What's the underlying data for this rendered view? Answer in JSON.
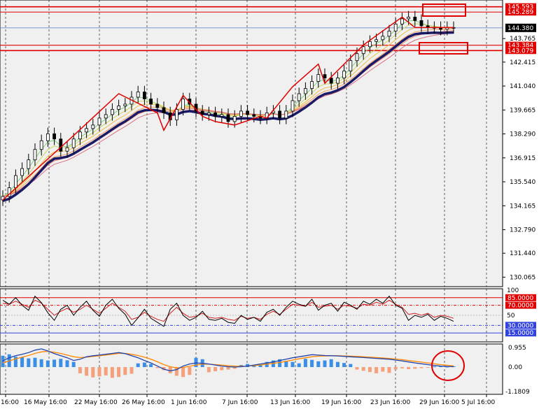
{
  "chart_data": {
    "type": "candlestick",
    "colors": {
      "background": "#f0f0f0",
      "grid": "#000000",
      "bull": "#000000",
      "bear": "#000000",
      "wave": "#e00000",
      "ma_slow": "#1a1a66",
      "level": "#e00000",
      "level_blue": "#5577cc",
      "current": "#000000",
      "hist_pos": "#3a8ee6",
      "hist_neg": "#f4a07a",
      "macd_line": "#2244aa",
      "signal_line": "#ff8800"
    },
    "price_panel": {
      "y_ticks": [
        "143.765",
        "142.415",
        "141.040",
        "139.665",
        "138.290",
        "136.915",
        "135.540",
        "134.165",
        "132.790",
        "131.440",
        "130.065"
      ],
      "ylim": [
        129.6,
        145.9
      ],
      "current_price": "144.380",
      "levels": [
        {
          "label": "145.593",
          "value": 145.593,
          "color": "#e00000",
          "width": 1.6
        },
        {
          "label": "145.289",
          "value": 145.289,
          "color": "#e00000",
          "width": 1
        },
        {
          "label": "143.384",
          "value": 143.384,
          "color": "#e00000",
          "width": 1.2
        },
        {
          "label": "143.079",
          "value": 143.079,
          "color": "#e00000",
          "width": 1.6
        }
      ],
      "blue_level": 144.38,
      "closes": [
        134.7,
        135.2,
        135.9,
        136.3,
        136.8,
        137.4,
        137.9,
        138.3,
        138.0,
        137.3,
        137.5,
        138.0,
        138.4,
        138.6,
        138.8,
        139.2,
        139.4,
        139.7,
        139.9,
        140.0,
        140.4,
        140.7,
        140.3,
        140.0,
        139.8,
        139.5,
        139.1,
        139.7,
        140.3,
        140.0,
        139.6,
        139.4,
        139.5,
        139.3,
        139.4,
        139.0,
        139.3,
        139.6,
        139.4,
        139.3,
        139.2,
        139.5,
        139.6,
        139.2,
        139.6,
        140.2,
        140.6,
        140.9,
        141.3,
        141.7,
        141.5,
        141.2,
        141.5,
        141.9,
        142.5,
        142.9,
        143.3,
        143.6,
        143.7,
        143.9,
        144.2,
        144.6,
        144.9,
        145.0,
        144.8,
        144.5,
        144.4,
        144.4,
        144.3,
        144.4,
        144.4
      ],
      "zigzag": [
        [
          0,
          134.5
        ],
        [
          11,
          138.2
        ],
        [
          18,
          140.6
        ],
        [
          24,
          139.5
        ],
        [
          25,
          138.5
        ],
        [
          28,
          140.5
        ],
        [
          31,
          139.3
        ],
        [
          33,
          139.0
        ],
        [
          36,
          138.8
        ],
        [
          40,
          139.3
        ],
        [
          41,
          139.2
        ],
        [
          45,
          141.0
        ],
        [
          49,
          142.3
        ],
        [
          50,
          141.2
        ],
        [
          56,
          143.4
        ],
        [
          62,
          145.0
        ],
        [
          64,
          144.4
        ],
        [
          70,
          144.4
        ]
      ]
    },
    "rsi_panel": {
      "levels": [
        {
          "label": "85.0000",
          "value": 85,
          "color": "#e00000",
          "dash": ""
        },
        {
          "label": "70.0000",
          "value": 70,
          "color": "#e00000",
          "dash": "4,2,1,2"
        },
        {
          "label": "30.0000",
          "value": 30,
          "color": "#3344dd",
          "dash": "4,2,1,2"
        },
        {
          "label": "15.0000",
          "value": 15,
          "color": "#3344dd",
          "dash": ""
        }
      ],
      "ticks": [
        "100",
        "50"
      ],
      "ylim": [
        0,
        100
      ],
      "black": [
        80,
        72,
        85,
        70,
        60,
        88,
        75,
        55,
        40,
        62,
        70,
        50,
        66,
        78,
        60,
        48,
        70,
        82,
        64,
        52,
        30,
        45,
        62,
        44,
        36,
        28,
        62,
        74,
        50,
        40,
        46,
        58,
        42,
        40,
        44,
        36,
        34,
        50,
        42,
        46,
        38,
        56,
        62,
        50,
        66,
        78,
        72,
        68,
        82,
        60,
        70,
        74,
        58,
        76,
        70,
        62,
        78,
        72,
        82,
        74,
        88,
        70,
        64,
        40,
        50,
        46,
        52,
        40,
        48,
        44,
        38
      ],
      "red": [
        74,
        72,
        78,
        72,
        66,
        80,
        74,
        62,
        50,
        58,
        64,
        56,
        62,
        70,
        62,
        54,
        64,
        74,
        66,
        58,
        42,
        46,
        56,
        48,
        42,
        38,
        54,
        66,
        54,
        46,
        48,
        54,
        46,
        44,
        46,
        42,
        40,
        48,
        44,
        46,
        42,
        52,
        58,
        52,
        62,
        72,
        70,
        68,
        76,
        66,
        68,
        70,
        62,
        70,
        68,
        64,
        72,
        70,
        76,
        72,
        80,
        72,
        66,
        52,
        54,
        50,
        54,
        46,
        50,
        48,
        44
      ]
    },
    "macd_panel": {
      "ticks": [
        "0.955",
        "0.00",
        "-1.1809"
      ],
      "ylim": [
        -1.25,
        1.05
      ],
      "hist": [
        0.55,
        0.62,
        0.5,
        0.48,
        0.42,
        0.45,
        0.38,
        0.32,
        0.36,
        0.4,
        0.33,
        0.25,
        -0.3,
        -0.42,
        -0.5,
        -0.45,
        -0.4,
        -0.52,
        -0.48,
        -0.38,
        -0.32,
        0.18,
        0.22,
        0.15,
        -0.05,
        -0.15,
        -0.3,
        -0.42,
        -0.48,
        -0.38,
        0.45,
        0.38,
        -0.25,
        -0.2,
        -0.15,
        -0.12,
        -0.08,
        0.1,
        0.15,
        0.08,
        0.12,
        0.25,
        0.32,
        0.38,
        0.3,
        0.25,
        0.18,
        0.4,
        0.35,
        0.28,
        0.32,
        0.38,
        0.25,
        0.2,
        0.15,
        -0.12,
        -0.18,
        -0.24,
        -0.3,
        -0.22,
        -0.28,
        -0.12,
        -0.06,
        -0.1,
        -0.08,
        -0.05,
        -0.02,
        0.03,
        0.05,
        0.02,
        0.04
      ],
      "macd": [
        0.3,
        0.45,
        0.55,
        0.62,
        0.7,
        0.82,
        0.88,
        0.78,
        0.65,
        0.55,
        0.45,
        0.32,
        0.38,
        0.5,
        0.55,
        0.58,
        0.62,
        0.66,
        0.7,
        0.65,
        0.55,
        0.45,
        0.32,
        0.2,
        0.05,
        -0.1,
        -0.18,
        -0.12,
        0.05,
        0.15,
        0.2,
        0.18,
        0.15,
        0.1,
        0.05,
        0.02,
        0.0,
        0.02,
        0.05,
        0.1,
        0.15,
        0.2,
        0.25,
        0.32,
        0.38,
        0.45,
        0.5,
        0.55,
        0.6,
        0.58,
        0.56,
        0.55,
        0.54,
        0.52,
        0.5,
        0.48,
        0.46,
        0.44,
        0.42,
        0.4,
        0.38,
        0.34,
        0.3,
        0.25,
        0.2,
        0.16,
        0.12,
        0.08,
        0.05,
        0.03,
        0.02
      ],
      "signal": [
        0.2,
        0.3,
        0.4,
        0.48,
        0.56,
        0.66,
        0.74,
        0.76,
        0.72,
        0.66,
        0.58,
        0.5,
        0.46,
        0.48,
        0.52,
        0.55,
        0.58,
        0.62,
        0.66,
        0.66,
        0.62,
        0.56,
        0.48,
        0.38,
        0.26,
        0.12,
        0.02,
        -0.04,
        -0.02,
        0.04,
        0.1,
        0.14,
        0.14,
        0.12,
        0.1,
        0.07,
        0.05,
        0.04,
        0.05,
        0.07,
        0.1,
        0.14,
        0.18,
        0.22,
        0.28,
        0.34,
        0.4,
        0.45,
        0.5,
        0.53,
        0.54,
        0.55,
        0.55,
        0.54,
        0.53,
        0.52,
        0.5,
        0.48,
        0.46,
        0.44,
        0.42,
        0.39,
        0.36,
        0.32,
        0.28,
        0.24,
        0.2,
        0.16,
        0.12,
        0.09,
        0.06
      ]
    },
    "x_labels": [
      "16:00",
      "16 May 16:00",
      "22 May 16:00",
      "26 May 16:00",
      "1 Jun 16:00",
      "7 Jun 16:00",
      "13 Jun 16:00",
      "19 Jun 16:00",
      "23 Jun 16:00",
      "29 Jun 16:00",
      "5 Jul 16:00"
    ]
  }
}
